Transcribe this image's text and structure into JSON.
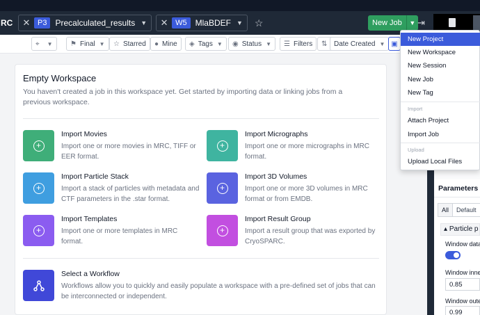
{
  "header": {
    "app_name": "RC",
    "tabs": [
      {
        "badge": "P3",
        "label": "Precalculated_results",
        "badge_color": "#3b5bdb"
      },
      {
        "badge": "W5",
        "label": "MlaBDEF",
        "badge_color": "#3b5bdb"
      }
    ],
    "new_job_label": "New Job"
  },
  "filters": {
    "final": "Final",
    "starred": "Starred",
    "mine": "Mine",
    "tags": "Tags",
    "status": "Status",
    "filters": "Filters",
    "date_created": "Date Created"
  },
  "workspace": {
    "title": "Empty Workspace",
    "subtitle": "You haven't created a job in this workspace yet. Get started by importing data or linking jobs from a previous workspace.",
    "items": [
      {
        "title": "Import Movies",
        "desc": "Import one or more movies in MRC, TIFF or EER format.",
        "color": "#3fae79"
      },
      {
        "title": "Import Micrographs",
        "desc": "Import one or more micrographs in MRC format.",
        "color": "#3fb4a0"
      },
      {
        "title": "Import Particle Stack",
        "desc": "Import a stack of particles with metadata and CTF parameters in the .star format.",
        "color": "#3f9ee0"
      },
      {
        "title": "Import 3D Volumes",
        "desc": "Import one or more 3D volumes in MRC format or from EMDB.",
        "color": "#5a63e0"
      },
      {
        "title": "Import Templates",
        "desc": "Import one or more templates in MRC format.",
        "color": "#8b5cf0"
      },
      {
        "title": "Import Result Group",
        "desc": "Import a result group that was exported by CryoSPARC.",
        "color": "#c24fe0"
      },
      {
        "title": "Select a Workflow",
        "desc": "Workflows allow you to quickly and easily populate a workspace with a pre-defined set of jobs that can be interconnected or independent.",
        "color": "#4048d8"
      }
    ]
  },
  "params": {
    "header": "Parameters",
    "seg_all": "All",
    "seg_default": "Default",
    "group": "Particle p",
    "label1": "Window data",
    "label2": "Window inne",
    "value2": "0.85",
    "label3": "Window oute",
    "value3": "0.99"
  },
  "menu": {
    "items_top": [
      "New Project",
      "New Workspace",
      "New Session",
      "New Job",
      "New Tag"
    ],
    "import_section": "Import",
    "items_import": [
      "Attach Project",
      "Import Job"
    ],
    "upload_section": "Upload",
    "items_upload": [
      "Upload Local Files"
    ]
  }
}
